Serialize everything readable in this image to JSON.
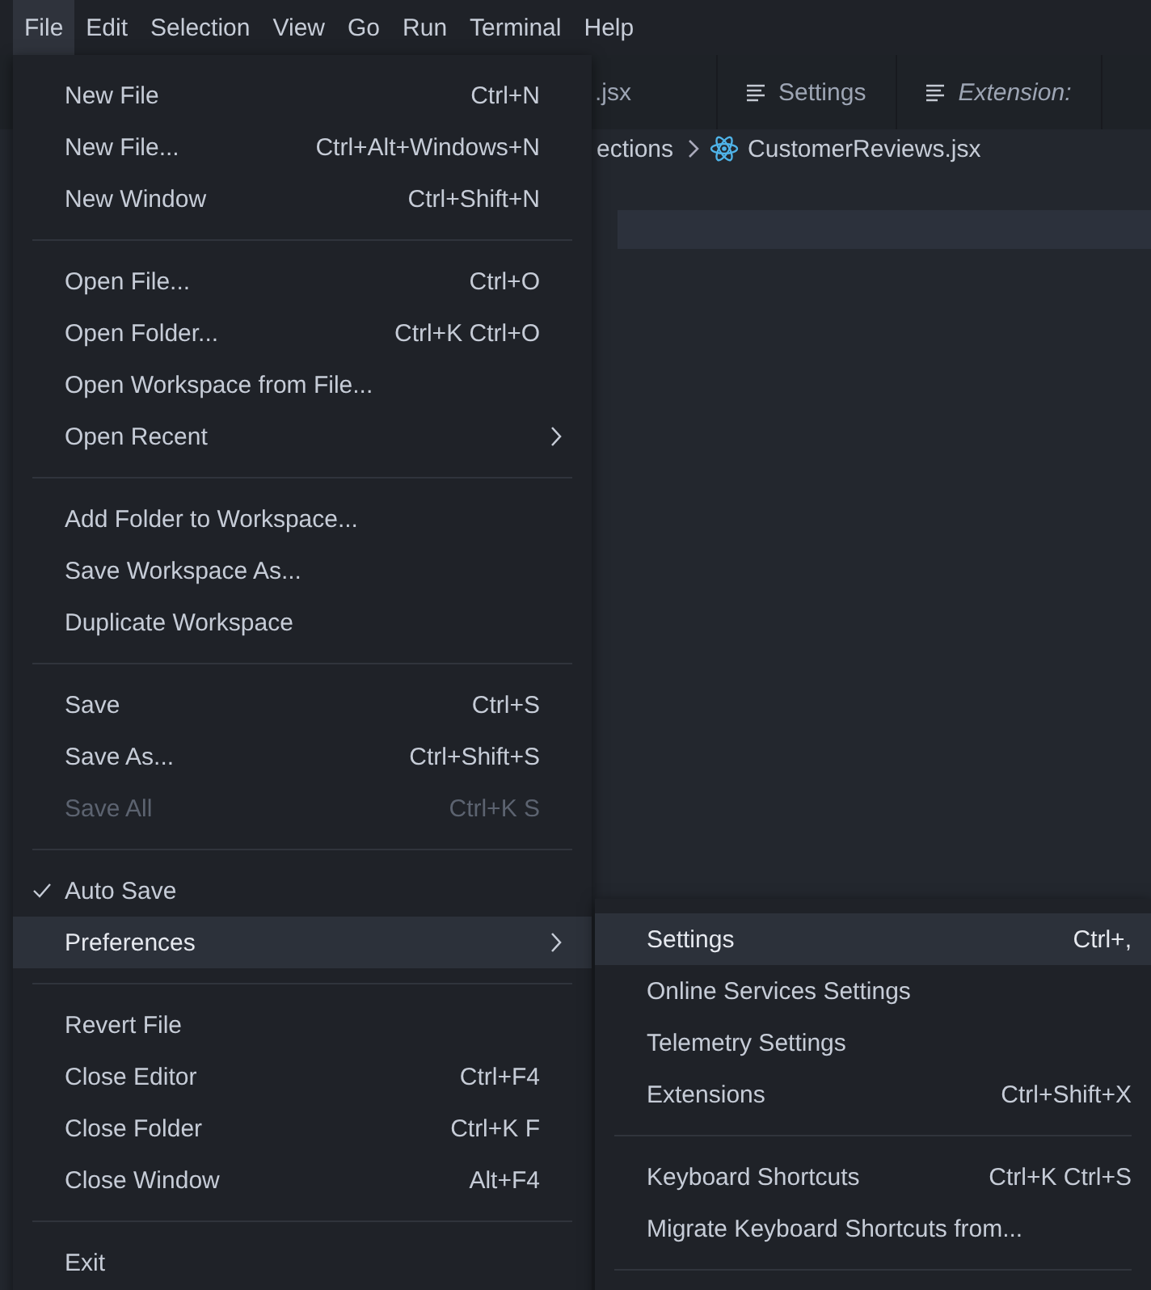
{
  "menubar": [
    {
      "label": "File",
      "selected": true
    },
    {
      "label": "Edit",
      "selected": false
    },
    {
      "label": "Selection",
      "selected": false
    },
    {
      "label": "View",
      "selected": false
    },
    {
      "label": "Go",
      "selected": false
    },
    {
      "label": "Run",
      "selected": false
    },
    {
      "label": "Terminal",
      "selected": false
    },
    {
      "label": "Help",
      "selected": false
    }
  ],
  "tabs": [
    {
      "label": ".jsx",
      "kind": "file",
      "italic": false
    },
    {
      "label": "Settings",
      "kind": "settings",
      "italic": false
    },
    {
      "label": "Extension: ",
      "kind": "settings",
      "italic": true
    }
  ],
  "breadcrumb": {
    "folder": "ections",
    "file": "CustomerReviews.jsx"
  },
  "file_menu": [
    {
      "kind": "item",
      "label": "New File",
      "shortcut": "Ctrl+N",
      "checked": false,
      "disabled": false,
      "selected": false,
      "submenu": false
    },
    {
      "kind": "item",
      "label": "New File...",
      "shortcut": "Ctrl+Alt+Windows+N",
      "checked": false,
      "disabled": false,
      "selected": false,
      "submenu": false
    },
    {
      "kind": "item",
      "label": "New Window",
      "shortcut": "Ctrl+Shift+N",
      "checked": false,
      "disabled": false,
      "selected": false,
      "submenu": false
    },
    {
      "kind": "separator"
    },
    {
      "kind": "item",
      "label": "Open File...",
      "shortcut": "Ctrl+O",
      "checked": false,
      "disabled": false,
      "selected": false,
      "submenu": false
    },
    {
      "kind": "item",
      "label": "Open Folder...",
      "shortcut": "Ctrl+K Ctrl+O",
      "checked": false,
      "disabled": false,
      "selected": false,
      "submenu": false
    },
    {
      "kind": "item",
      "label": "Open Workspace from File...",
      "checked": false,
      "disabled": false,
      "selected": false,
      "submenu": false
    },
    {
      "kind": "item",
      "label": "Open Recent",
      "checked": false,
      "disabled": false,
      "selected": false,
      "submenu": true
    },
    {
      "kind": "separator"
    },
    {
      "kind": "item",
      "label": "Add Folder to Workspace...",
      "checked": false,
      "disabled": false,
      "selected": false,
      "submenu": false
    },
    {
      "kind": "item",
      "label": "Save Workspace As...",
      "checked": false,
      "disabled": false,
      "selected": false,
      "submenu": false
    },
    {
      "kind": "item",
      "label": "Duplicate Workspace",
      "checked": false,
      "disabled": false,
      "selected": false,
      "submenu": false
    },
    {
      "kind": "separator"
    },
    {
      "kind": "item",
      "label": "Save",
      "shortcut": "Ctrl+S",
      "checked": false,
      "disabled": false,
      "selected": false,
      "submenu": false
    },
    {
      "kind": "item",
      "label": "Save As...",
      "shortcut": "Ctrl+Shift+S",
      "checked": false,
      "disabled": false,
      "selected": false,
      "submenu": false
    },
    {
      "kind": "item",
      "label": "Save All",
      "shortcut": "Ctrl+K S",
      "checked": false,
      "disabled": true,
      "selected": false,
      "submenu": false
    },
    {
      "kind": "separator"
    },
    {
      "kind": "item",
      "label": "Auto Save",
      "checked": true,
      "disabled": false,
      "selected": false,
      "submenu": false
    },
    {
      "kind": "item",
      "label": "Preferences",
      "checked": false,
      "disabled": false,
      "selected": true,
      "submenu": true
    },
    {
      "kind": "separator"
    },
    {
      "kind": "item",
      "label": "Revert File",
      "checked": false,
      "disabled": false,
      "selected": false,
      "submenu": false
    },
    {
      "kind": "item",
      "label": "Close Editor",
      "shortcut": "Ctrl+F4",
      "checked": false,
      "disabled": false,
      "selected": false,
      "submenu": false
    },
    {
      "kind": "item",
      "label": "Close Folder",
      "shortcut": "Ctrl+K F",
      "checked": false,
      "disabled": false,
      "selected": false,
      "submenu": false
    },
    {
      "kind": "item",
      "label": "Close Window",
      "shortcut": "Alt+F4",
      "checked": false,
      "disabled": false,
      "selected": false,
      "submenu": false
    },
    {
      "kind": "separator"
    },
    {
      "kind": "item",
      "label": "Exit",
      "checked": false,
      "disabled": false,
      "selected": false,
      "submenu": false
    }
  ],
  "preferences_menu": [
    {
      "kind": "item",
      "label": "Settings",
      "shortcut": "Ctrl+,",
      "selected": true
    },
    {
      "kind": "item",
      "label": "Online Services Settings",
      "selected": false
    },
    {
      "kind": "item",
      "label": "Telemetry Settings",
      "selected": false
    },
    {
      "kind": "item",
      "label": "Extensions",
      "shortcut": "Ctrl+Shift+X",
      "selected": false
    },
    {
      "kind": "separator"
    },
    {
      "kind": "item",
      "label": "Keyboard Shortcuts",
      "shortcut": "Ctrl+K Ctrl+S",
      "selected": false
    },
    {
      "kind": "item",
      "label": "Migrate Keyboard Shortcuts from...",
      "selected": false
    },
    {
      "kind": "separator"
    }
  ]
}
